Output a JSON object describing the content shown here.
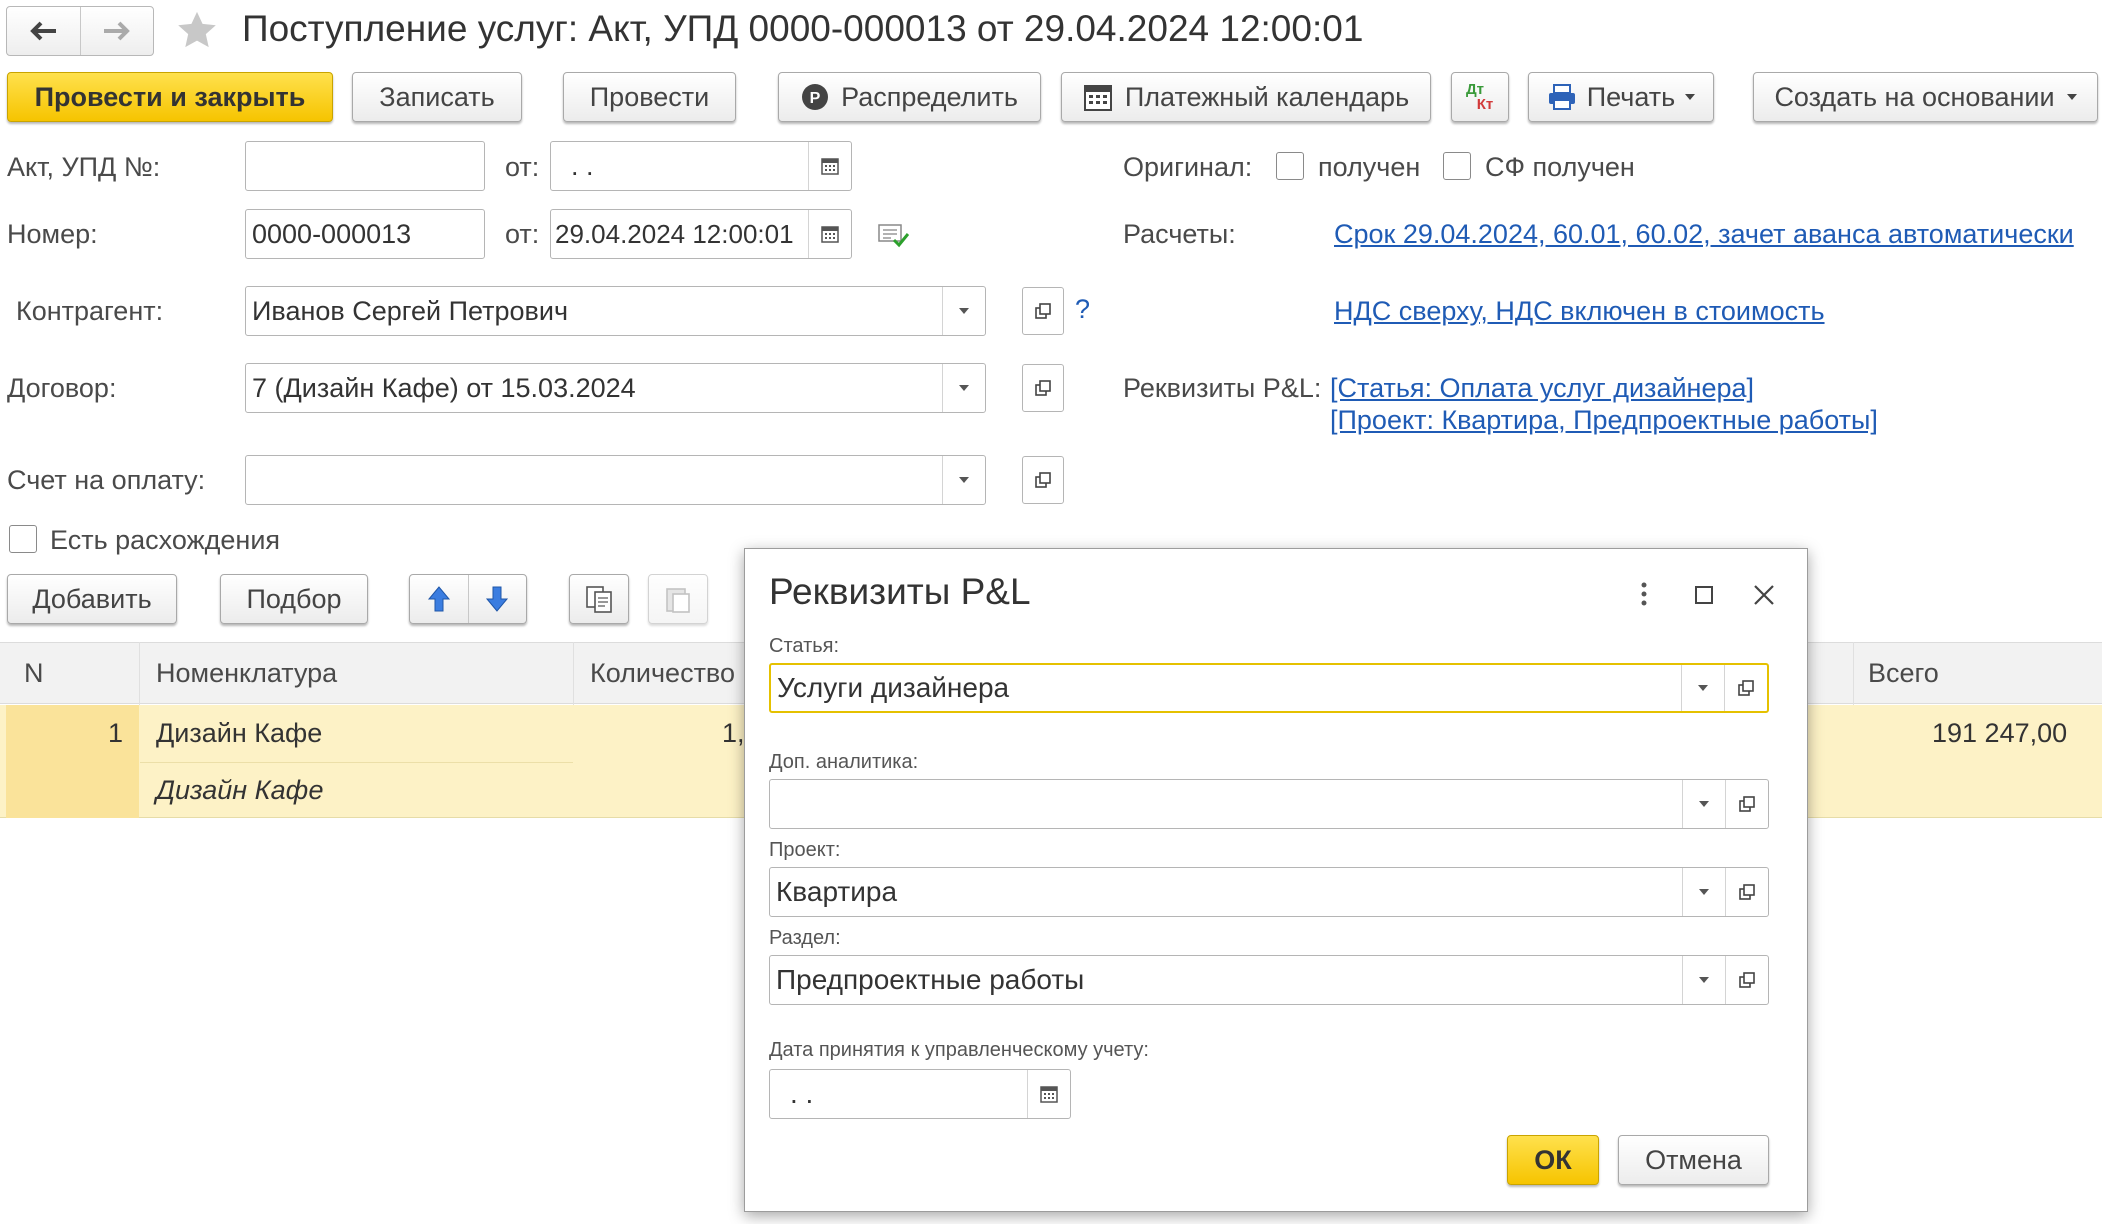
{
  "window": {
    "title": "Поступление услуг: Акт, УПД 0000-000013 от 29.04.2024 12:00:01"
  },
  "toolbar": {
    "post_close": "Провести и закрыть",
    "save": "Записать",
    "post": "Провести",
    "distribute": "Распределить",
    "payment_calendar": "Платежный календарь",
    "dt_kt_top": "Дт",
    "dt_kt_bottom": "Кт",
    "print": "Печать",
    "create_based": "Создать на основании"
  },
  "form": {
    "act_label": "Акт, УПД №:",
    "act_value": "",
    "from_label": "от:",
    "act_date": ". .",
    "original_label": "Оригинал:",
    "received_label": "получен",
    "sf_received_label": "СФ получен",
    "number_label": "Номер:",
    "number_value": "0000-000013",
    "from_label2": "от:",
    "number_date": "29.04.2024 12:00:01",
    "settlements_label": "Расчеты:",
    "settlements_link": "Срок 29.04.2024, 60.01, 60.02, зачет аванса автоматически",
    "counterparty_label": "Контрагент:",
    "counterparty_value": "Иванов Сергей Петрович",
    "help": "?",
    "vat_link": "НДС сверху, НДС включен в стоимость",
    "contract_label": "Договор:",
    "contract_value": "7 (Дизайн Кафе) от 15.03.2024",
    "pl_label": "Реквизиты P&L:",
    "pl_link1": "[Статья: Оплата услуг дизайнера]",
    "pl_link2": "[Проект: Квартира, Предпроектные работы]",
    "invoice_label": "Счет на оплату:",
    "invoice_value": "",
    "discrepancy_label": "Есть расхождения"
  },
  "table_toolbar": {
    "add": "Добавить",
    "select": "Подбор"
  },
  "table": {
    "columns": [
      "N",
      "Номенклатура",
      "Количество",
      "Всего"
    ],
    "rows": [
      {
        "n": "1",
        "item": "Дизайн Кафе",
        "item_sub": "Дизайн Кафе",
        "qty": "1,",
        "total": "191 247,00"
      }
    ]
  },
  "dialog": {
    "title": "Реквизиты P&L",
    "article_label": "Статья:",
    "article_value": "Услуги дизайнера",
    "analytics_label": "Доп. аналитика:",
    "analytics_value": "",
    "project_label": "Проект:",
    "project_value": "Квартира",
    "section_label": "Раздел:",
    "section_value": "Предпроектные работы",
    "date_label": "Дата принятия к управленческому учету:",
    "date_value": ". .",
    "ok": "ОК",
    "cancel": "Отмена"
  },
  "colors": {
    "accent_yellow": "#f6c400",
    "row_highlight": "#fdf2c6",
    "row_highlight_n": "#fae39a",
    "link_blue": "#1f5bb5",
    "focus_border": "#e5c100"
  }
}
